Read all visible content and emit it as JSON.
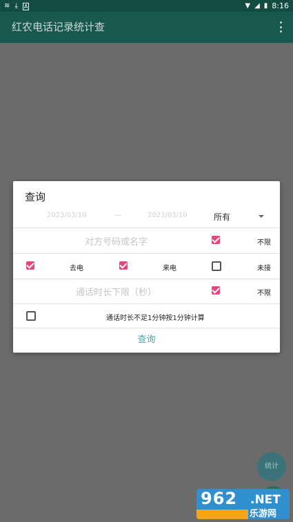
{
  "status_bar": {
    "time": "8:16",
    "icons": [
      "signal-icon",
      "download-icon",
      "a-icon",
      "wifi-icon",
      "cell-signal-icon",
      "battery-icon"
    ]
  },
  "app_bar": {
    "title": "红农电话记录统计查",
    "menu_icon": "overflow-menu-icon"
  },
  "dialog": {
    "title": "查询",
    "date_range": {
      "start": "2023/03/10",
      "separator": "—",
      "end": "2023/03/10"
    },
    "call_type_select": {
      "value": "所有"
    },
    "contact_filter": {
      "placeholder": "对方号码或名字",
      "checked": true,
      "label": "不限"
    },
    "call_direction": {
      "outgoing_label": "去电",
      "outgoing_checked": true,
      "incoming_label": "来电",
      "incoming_checked": true,
      "missed_label": "未接",
      "missed_checked": false
    },
    "duration_filter": {
      "placeholder": "通话时长下限（秒）",
      "checked": true,
      "label": "不限"
    },
    "rounding": {
      "checked": false,
      "label": "通话时长不足1分钟按1分钟计算"
    },
    "query_button": "查询"
  },
  "fab": {
    "stats_label": "统计"
  },
  "watermark": {
    "number": "962",
    "domain": ".NET",
    "name": "乐游网"
  },
  "colors": {
    "app_bar": "#175a4d",
    "status_bar": "#124b3f",
    "checkbox_accent": "#e8457a",
    "link_teal": "#4aa8a2",
    "scrim": "#6b6b6b"
  }
}
